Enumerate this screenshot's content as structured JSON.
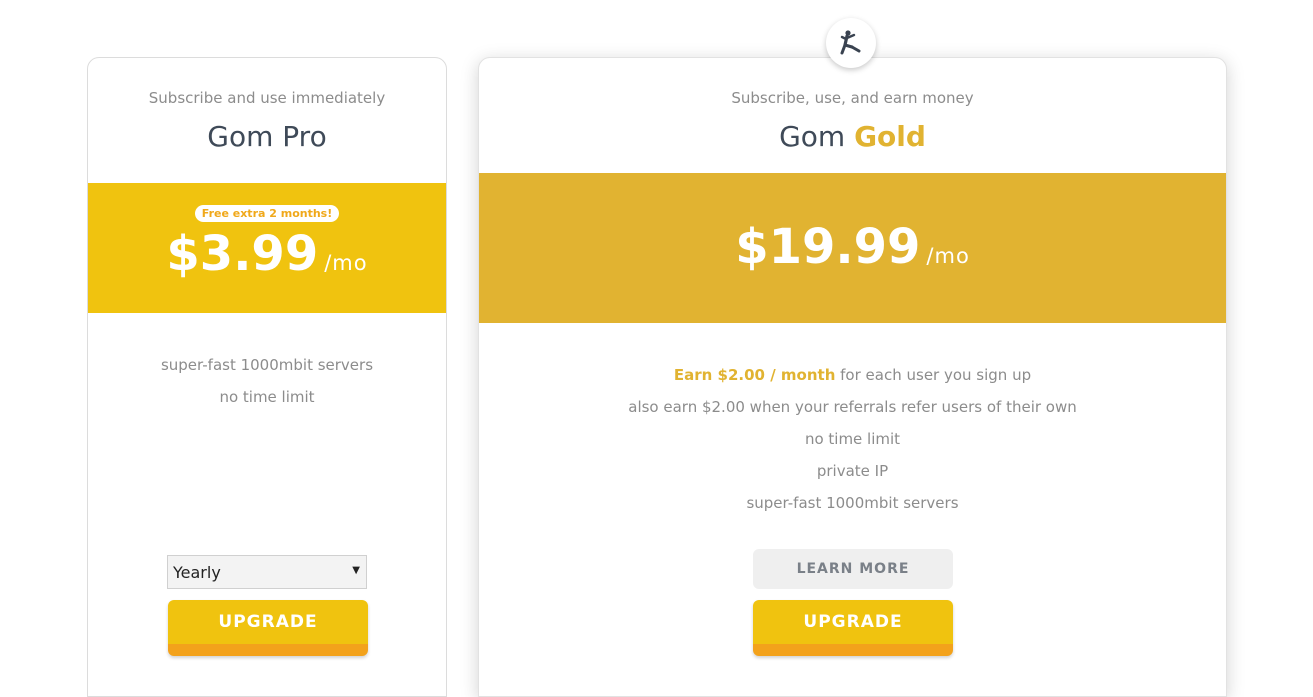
{
  "colors": {
    "pro_band": "#f0c30f",
    "gold_band": "#e1b331",
    "upgrade_button": "#f0c30f",
    "upgrade_button_bottom": "#f3a21b",
    "accent_gold": "#e1b331",
    "title_dark": "#3f4a58"
  },
  "logo": {
    "icon": "jumping-figure-icon"
  },
  "pro": {
    "subtitle": "Subscribe and use immediately",
    "name": "Gom Pro",
    "badge": "Free extra 2 months!",
    "price": "$3.99",
    "per": "/mo",
    "features": [
      "super-fast 1000mbit servers",
      "no time limit"
    ],
    "billing_select": {
      "value": "Yearly",
      "icon": "dropdown-arrow-icon"
    },
    "upgrade_label": "UPGRADE"
  },
  "gold": {
    "subtitle": "Subscribe, use, and earn money",
    "name_prefix": "Gom",
    "name_highlight": "Gold",
    "price": "$19.99",
    "per": "/mo",
    "earn_highlight": "Earn $2.00 / month",
    "earn_rest": "for each user you sign up",
    "features": [
      "also earn $2.00 when your referrals refer users of their own",
      "no time limit",
      "private IP",
      "super-fast 1000mbit servers"
    ],
    "learn_more_label": "LEARN MORE",
    "upgrade_label": "UPGRADE"
  }
}
